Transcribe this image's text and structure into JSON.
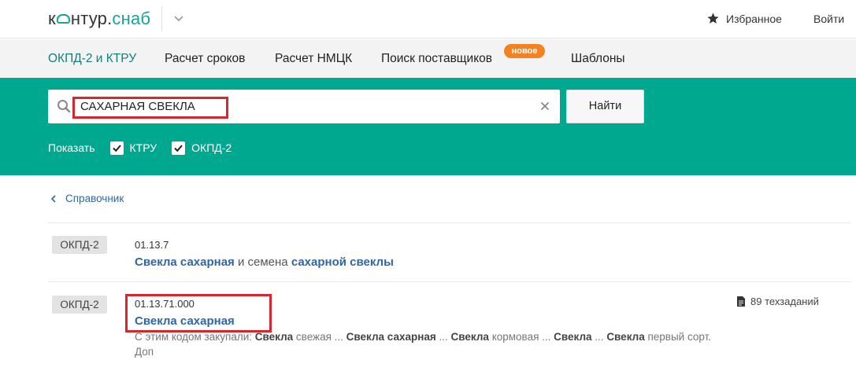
{
  "header": {
    "logo_part1": "к",
    "logo_part2": "нтур.",
    "logo_part3": "снаб",
    "favorites": "Избранное",
    "login": "Войти"
  },
  "nav": {
    "items": [
      "ОКПД-2 и КТРУ",
      "Расчет сроков",
      "Расчет НМЦК",
      "Поиск поставщиков",
      "Шаблоны"
    ],
    "active_index": 0,
    "badge": "новое"
  },
  "search": {
    "value": "САХАРНАЯ СВЕКЛА",
    "button": "Найти",
    "show_label": "Показать",
    "filters": [
      {
        "label": "КТРУ",
        "checked": true
      },
      {
        "label": "ОКПД-2",
        "checked": true
      }
    ]
  },
  "content": {
    "back_link": "Справочник",
    "results": [
      {
        "tag": "ОКПД-2",
        "code": "01.13.7",
        "title_bold1": "Свекла сахарная",
        "title_mid": " и семена ",
        "title_bold2": "сахарной свеклы"
      },
      {
        "tag": "ОКПД-2",
        "code": "01.13.71.000",
        "title": "Свекла сахарная",
        "tasks": "89 техзаданий",
        "snippet_prefix": "С этим кодом закупали: ",
        "snippet_parts": [
          {
            "b": "Свекла",
            "t": " свежая ... "
          },
          {
            "b": "Свекла сахарная",
            "t": " ... "
          },
          {
            "b": "Свекла",
            "t": " кормовая ... "
          },
          {
            "b": "Свекла",
            "t": " ... "
          },
          {
            "b": "Свекла",
            "t": " первый сорт."
          }
        ],
        "snippet_more": "Доп"
      }
    ]
  },
  "colors": {
    "brand": "#00a88f",
    "link": "#2f66a6",
    "badge": "#f58220",
    "highlight": "#d9262c"
  }
}
